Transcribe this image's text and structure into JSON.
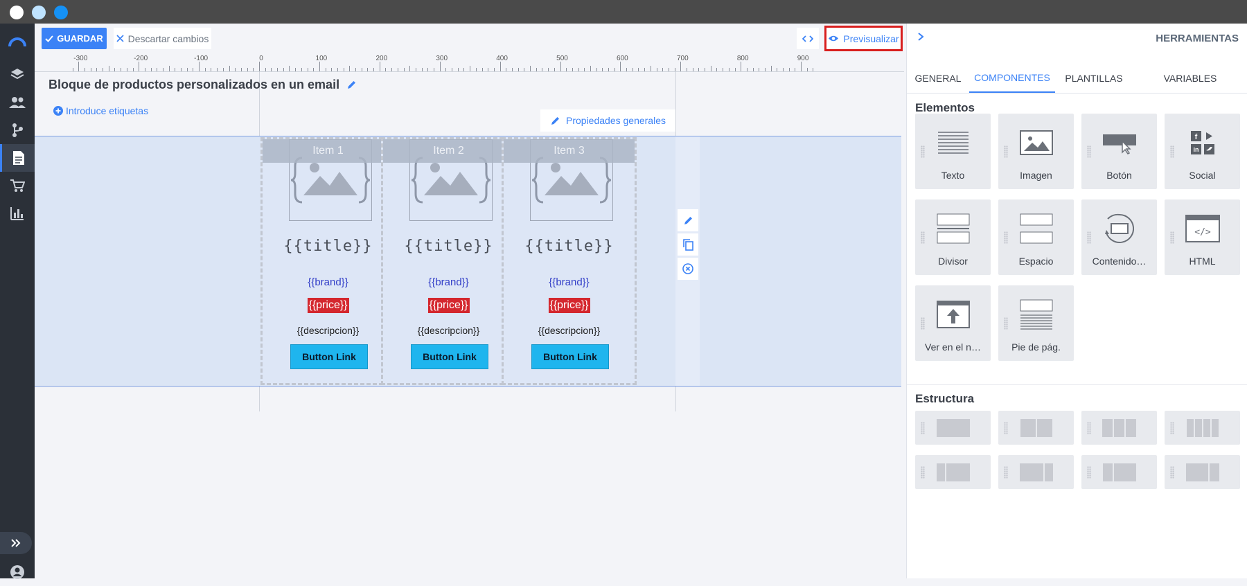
{
  "toolbar": {
    "save_label": "GUARDAR",
    "discard_label": "Descartar cambios",
    "preview_label": "Previsualizar"
  },
  "ruler": {
    "ticks": [
      "-300",
      "-200",
      "-100",
      "0",
      "100",
      "200",
      "300",
      "400",
      "500",
      "600",
      "700",
      "800",
      "900"
    ]
  },
  "page": {
    "title": "Bloque de productos personalizados en un email",
    "tags_label": "Introduce etiquetas",
    "props_label": "Propiedades generales"
  },
  "items": [
    {
      "header": "Item 1",
      "title": "{{title}}",
      "brand": "{{brand}}",
      "price": "{{price}}",
      "desc": "{{descripcion}}",
      "button": "Button Link"
    },
    {
      "header": "Item 2",
      "title": "{{title}}",
      "brand": "{{brand}}",
      "price": "{{price}}",
      "desc": "{{descripcion}}",
      "button": "Button Link"
    },
    {
      "header": "Item 3",
      "title": "{{title}}",
      "brand": "{{brand}}",
      "price": "{{price}}",
      "desc": "{{descripcion}}",
      "button": "Button Link"
    }
  ],
  "panel": {
    "title": "HERRAMIENTAS",
    "tabs": [
      "GENERAL",
      "COMPONENTES",
      "PLANTILLAS",
      "VARIABLES"
    ],
    "active_tab": "COMPONENTES",
    "elements_heading": "Elementos",
    "elements": [
      "Texto",
      "Imagen",
      "Botón",
      "Social",
      "Divisor",
      "Espacio",
      "Contenido…",
      "HTML",
      "Ver en el n…",
      "Pie de pág."
    ],
    "structure_heading": "Estructura"
  },
  "colors": {
    "accent": "#3b82f6",
    "price_bg": "#d4272e",
    "button_bg": "#1fb5ee",
    "highlight": "#d81e1e"
  }
}
